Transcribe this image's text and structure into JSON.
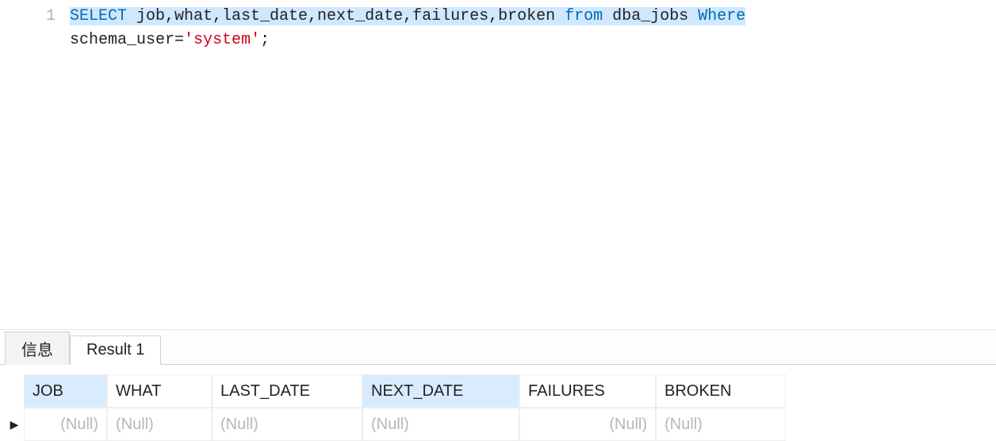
{
  "editor": {
    "line_numbers": [
      "1"
    ],
    "sql": {
      "kw_select": "SELECT",
      "cols": " job,what,last_date,next_date,failures,broken ",
      "kw_from": "from",
      "table": " dba_jobs ",
      "kw_where": "Where",
      "newline_part": "schema_user=",
      "str_open": "'",
      "str_val": "system",
      "str_close": "'",
      "tail": ";"
    }
  },
  "tabs": {
    "info": "信息",
    "result": "Result 1"
  },
  "grid": {
    "row_arrow": "▶",
    "columns": [
      {
        "label": "JOB",
        "selected": true,
        "align": "right"
      },
      {
        "label": "WHAT",
        "selected": false,
        "align": "left"
      },
      {
        "label": "LAST_DATE",
        "selected": false,
        "align": "left"
      },
      {
        "label": "NEXT_DATE",
        "selected": true,
        "align": "left"
      },
      {
        "label": "FAILURES",
        "selected": false,
        "align": "right"
      },
      {
        "label": "BROKEN",
        "selected": false,
        "align": "left"
      }
    ],
    "rows": [
      [
        "(Null)",
        "(Null)",
        "(Null)",
        "(Null)",
        "(Null)",
        "(Null)"
      ]
    ]
  }
}
